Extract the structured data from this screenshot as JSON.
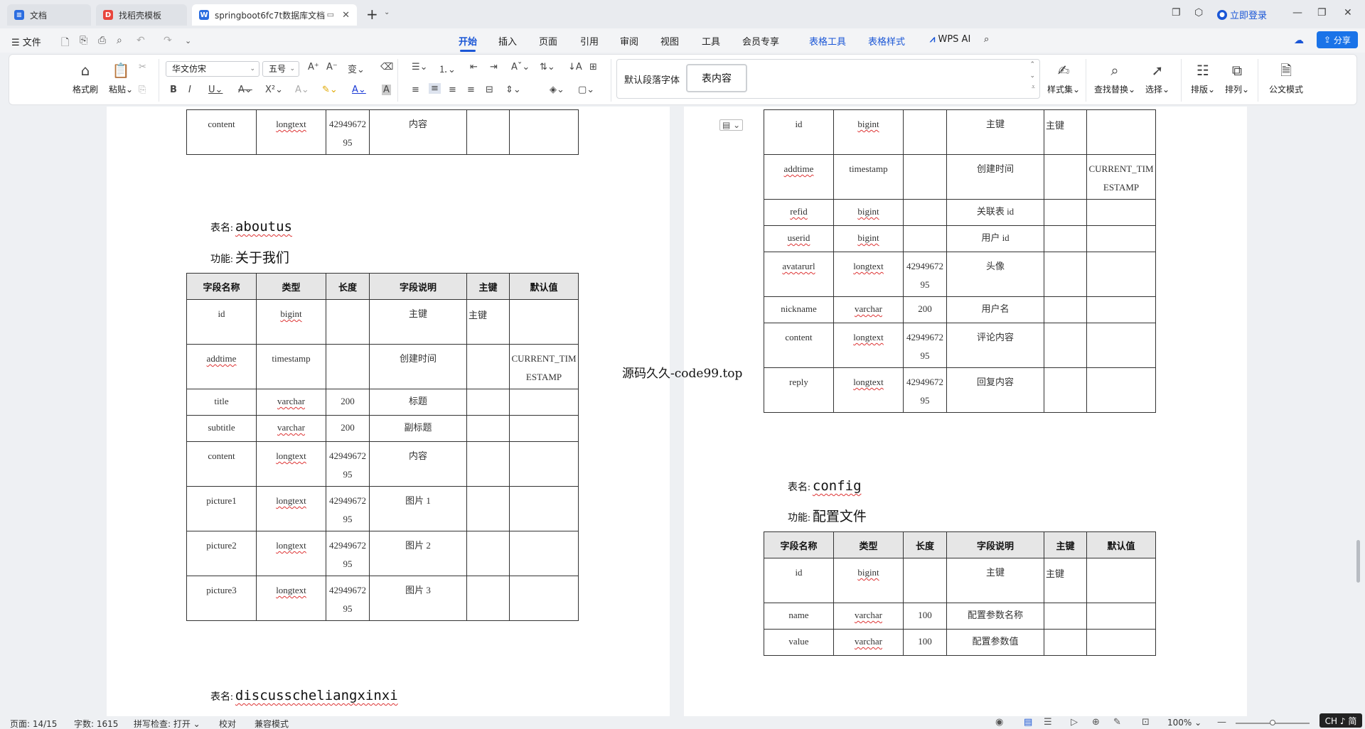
{
  "tabs": [
    {
      "label": "文档",
      "icon": "doc-icon"
    },
    {
      "label": "找稻壳模板",
      "icon": "docer-icon"
    },
    {
      "label": "springboot6fc7t数据库文档",
      "icon": "wps-writer-icon"
    }
  ],
  "window": {
    "login": "立即登录"
  },
  "menu": {
    "file": "文件",
    "tabs": [
      "开始",
      "插入",
      "页面",
      "引用",
      "审阅",
      "视图",
      "工具",
      "会员专享",
      "表格工具",
      "表格样式"
    ],
    "wps_ai": "WPS AI",
    "share": "分享"
  },
  "ribbon": {
    "format_painter": "格式刷",
    "paste": "粘贴",
    "font_name": "华文仿宋",
    "font_size": "五号",
    "styles": [
      "默认段落字体",
      "表内容"
    ],
    "style_set": "样式集",
    "find_replace": "查找替换",
    "select": "选择",
    "layout": "排版",
    "arrange": "排列",
    "official_mode": "公文模式"
  },
  "headers": [
    "字段名称",
    "类型",
    "长度",
    "字段说明",
    "主键",
    "默认值"
  ],
  "left_page": {
    "prev_table_tail": [
      [
        "content",
        "longtext",
        "4294967295",
        "内容",
        "",
        ""
      ]
    ],
    "aboutus": {
      "name_label": "表名:",
      "name": "aboutus",
      "func_label": "功能:",
      "func": "关于我们",
      "rows": [
        [
          "id",
          "bigint",
          "",
          "主键",
          "主键",
          ""
        ],
        [
          "addtime",
          "timestamp",
          "",
          "创建时间",
          "",
          "CURRENT_TIMESTAMP"
        ],
        [
          "title",
          "varchar",
          "200",
          "标题",
          "",
          ""
        ],
        [
          "subtitle",
          "varchar",
          "200",
          "副标题",
          "",
          ""
        ],
        [
          "content",
          "longtext",
          "4294967295",
          "内容",
          "",
          ""
        ],
        [
          "picture1",
          "longtext",
          "4294967295",
          "图片 1",
          "",
          ""
        ],
        [
          "picture2",
          "longtext",
          "4294967295",
          "图片 2",
          "",
          ""
        ],
        [
          "picture3",
          "longtext",
          "4294967295",
          "图片 3",
          "",
          ""
        ]
      ]
    },
    "next": {
      "name_label": "表名:",
      "name": "discusscheliangxinxi"
    }
  },
  "right_page": {
    "prev_table_rows": [
      [
        "id",
        "bigint",
        "",
        "主键",
        "主键",
        ""
      ],
      [
        "addtime",
        "timestamp",
        "",
        "创建时间",
        "",
        "CURRENT_TIMESTAMP"
      ],
      [
        "refid",
        "bigint",
        "",
        "关联表 id",
        "",
        ""
      ],
      [
        "userid",
        "bigint",
        "",
        "用户 id",
        "",
        ""
      ],
      [
        "avatarurl",
        "longtext",
        "4294967295",
        "头像",
        "",
        ""
      ],
      [
        "nickname",
        "varchar",
        "200",
        "用户名",
        "",
        ""
      ],
      [
        "content",
        "longtext",
        "4294967295",
        "评论内容",
        "",
        ""
      ],
      [
        "reply",
        "longtext",
        "4294967295",
        "回复内容",
        "",
        ""
      ]
    ],
    "config": {
      "name_label": "表名:",
      "name": "config",
      "func_label": "功能:",
      "func": "配置文件",
      "rows": [
        [
          "id",
          "bigint",
          "",
          "主键",
          "主键",
          ""
        ],
        [
          "name",
          "varchar",
          "100",
          "配置参数名称",
          "",
          ""
        ],
        [
          "value",
          "varchar",
          "100",
          "配置参数值",
          "",
          ""
        ]
      ]
    }
  },
  "watermark": "源码久久-code99.top",
  "status": {
    "page": "页面: 14/15",
    "words": "字数: 1615",
    "spell": "拼写检查: 打开",
    "proof": "校对",
    "compat": "兼容模式",
    "zoom": "100%",
    "ime": "CH ♪ 简"
  }
}
